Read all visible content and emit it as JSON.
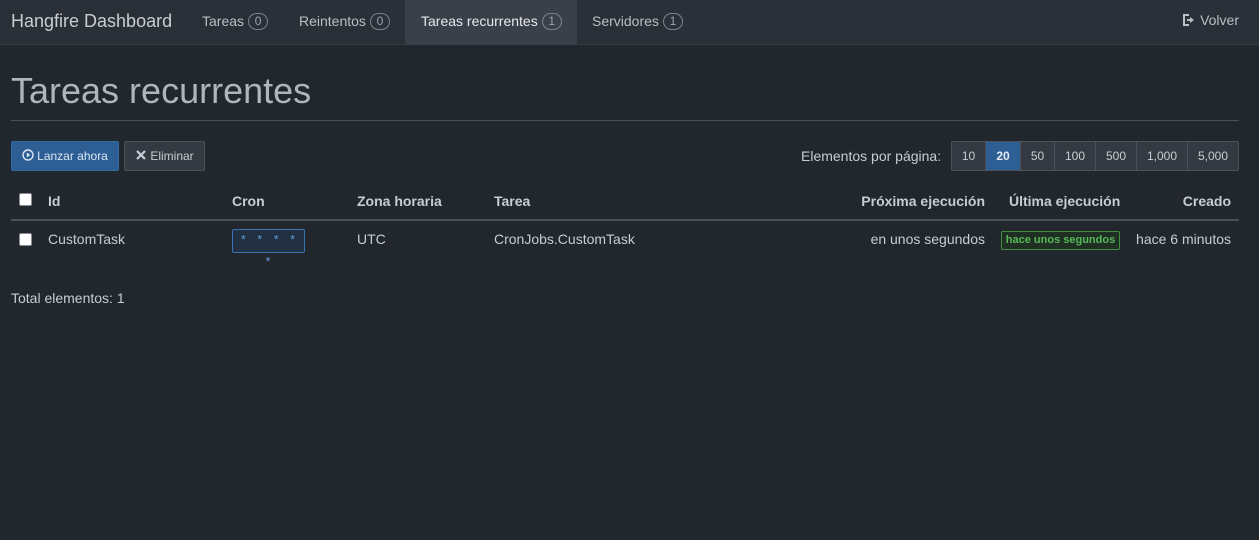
{
  "navbar": {
    "brand": "Hangfire Dashboard",
    "items": [
      {
        "label": "Tareas",
        "count": "0"
      },
      {
        "label": "Reintentos",
        "count": "0"
      },
      {
        "label": "Tareas recurrentes",
        "count": "1"
      },
      {
        "label": "Servidores",
        "count": "1"
      }
    ],
    "active": "Tareas recurrentes",
    "back_label": "Volver"
  },
  "page": {
    "title": "Tareas recurrentes",
    "trigger_label": "Lanzar ahora",
    "delete_label": "Eliminar",
    "per_page_label": "Elementos por página:",
    "per_page_options": [
      "10",
      "20",
      "50",
      "100",
      "500",
      "1,000",
      "5,000"
    ],
    "per_page_selected": "20"
  },
  "table": {
    "headers": {
      "id": "Id",
      "cron": "Cron",
      "timezone": "Zona horaria",
      "job": "Tarea",
      "next": "Próxima ejecución",
      "last": "Última ejecución",
      "created": "Creado"
    },
    "rows": [
      {
        "id": "CustomTask",
        "cron": "* * * * *",
        "timezone": "UTC",
        "job": "CronJobs.CustomTask",
        "next": "en unos segundos",
        "last": "hace unos segundos",
        "created": "hace 6 minutos"
      }
    ]
  },
  "footer": {
    "total": "Total elementos: 1"
  },
  "colors": {
    "background": "#22262d",
    "navbar": "#2b3038",
    "primary": "#2d5f95",
    "cron_badge": "#5fa0e6",
    "success_badge": "#58b858"
  }
}
